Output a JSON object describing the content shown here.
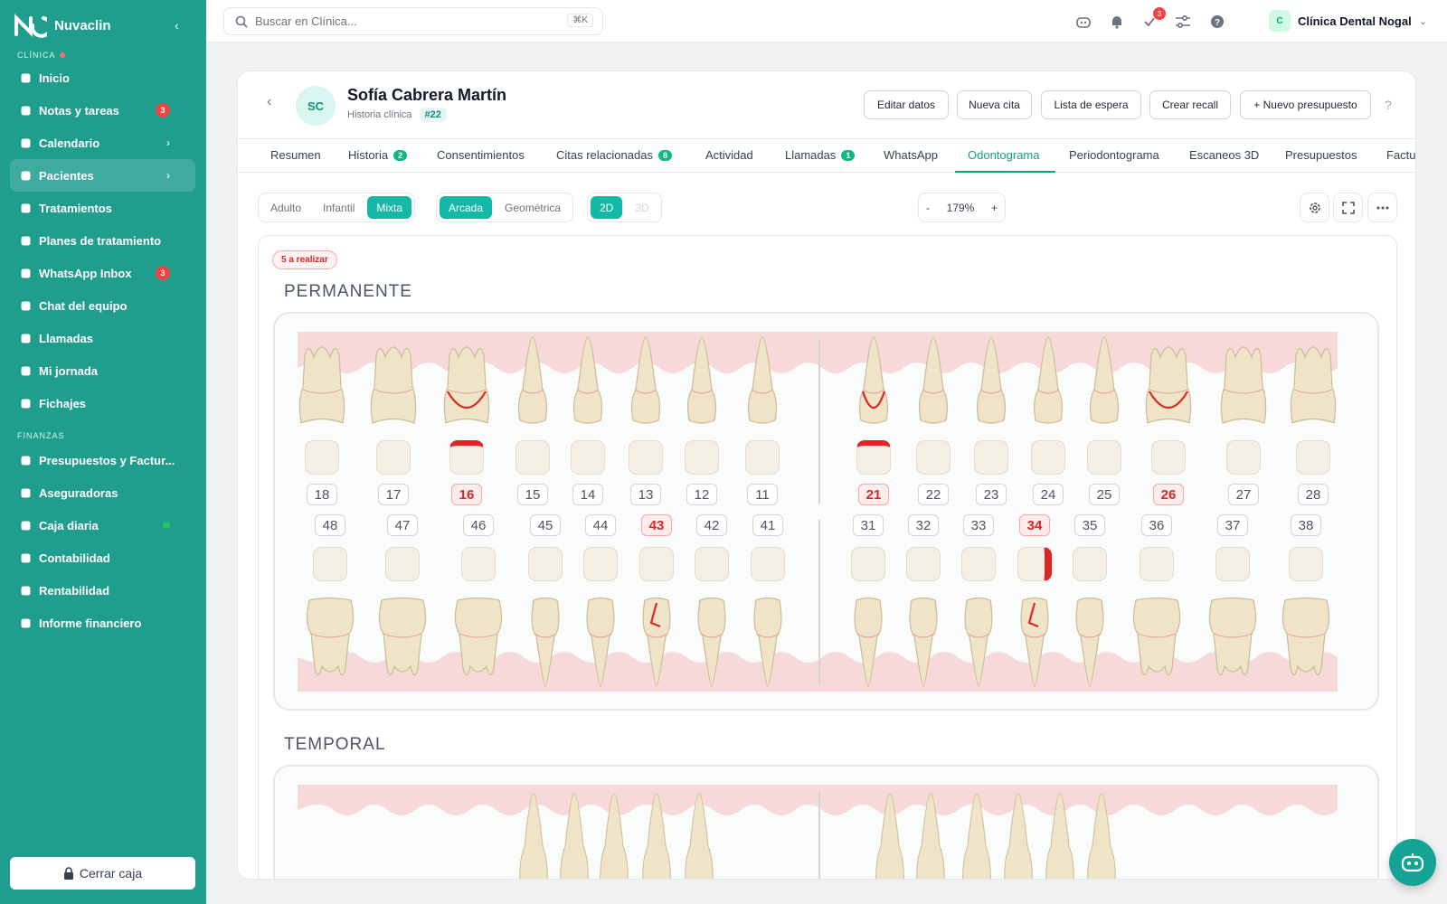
{
  "app": {
    "brand": "Nuvaclin"
  },
  "sidebar": {
    "section_clinic": "CLÍNICA",
    "section_finance": "FINANZAS",
    "items": [
      {
        "label": "Inicio",
        "icon": "home-icon"
      },
      {
        "label": "Notas y tareas",
        "icon": "notes-icon",
        "badge": "3"
      },
      {
        "label": "Calendario",
        "icon": "calendar-icon"
      },
      {
        "label": "Pacientes",
        "icon": "users-icon",
        "active": true
      },
      {
        "label": "Tratamientos",
        "icon": "flask-icon"
      },
      {
        "label": "Planes de tratamiento",
        "icon": "clipboard-icon"
      },
      {
        "label": "WhatsApp Inbox",
        "icon": "chat-icon",
        "badge": "3"
      },
      {
        "label": "Chat del equipo",
        "icon": "team-chat-icon"
      },
      {
        "label": "Llamadas",
        "icon": "phone-icon"
      },
      {
        "label": "Mi jornada",
        "icon": "clock-icon"
      },
      {
        "label": "Fichajes",
        "icon": "briefcase-icon"
      },
      {
        "label": "Presupuestos y Factur...",
        "icon": "document-icon"
      },
      {
        "label": "Aseguradoras",
        "icon": "shield-icon"
      },
      {
        "label": "Caja diaria",
        "icon": "cash-icon"
      },
      {
        "label": "Contabilidad",
        "icon": "ledger-icon"
      },
      {
        "label": "Rentabilidad",
        "icon": "trend-icon"
      },
      {
        "label": "Informe financiero",
        "icon": "bar-chart-icon"
      }
    ],
    "close_register": "Cerrar caja"
  },
  "topbar": {
    "search_placeholder": "Buscar en Clínica...",
    "search_shortcut": "⌘K",
    "tasks_badge": "3",
    "clinic_initial": "C",
    "clinic_name": "Clínica Dental Nogal"
  },
  "patient": {
    "initials": "SC",
    "name": "Sofía Cabrera Martín",
    "subtitle": "Historia clínica",
    "id": "#22",
    "actions": [
      "Editar datos",
      "Nueva cita",
      "Lista de espera",
      "Crear recall",
      "+ Nuevo presupuesto"
    ]
  },
  "tabs": [
    {
      "label": "Resumen"
    },
    {
      "label": "Historia",
      "badge": "2"
    },
    {
      "label": "Consentimientos"
    },
    {
      "label": "Citas relacionadas",
      "badge": "8"
    },
    {
      "label": "Actividad"
    },
    {
      "label": "Llamadas",
      "badge": "1"
    },
    {
      "label": "WhatsApp"
    },
    {
      "label": "Odontograma",
      "active": true
    },
    {
      "label": "Periodontograma"
    },
    {
      "label": "Escaneos 3D"
    },
    {
      "label": "Presupuestos"
    },
    {
      "label": "Factu"
    }
  ],
  "toolbar": {
    "dentition": [
      "Adulto",
      "Infantil",
      "Mixta"
    ],
    "dentition_selected": "Mixta",
    "view": [
      "Arcada",
      "Geométrica"
    ],
    "view_selected": "Arcada",
    "mode": [
      "2D",
      "3D"
    ],
    "mode_selected": "2D",
    "zoom_minus": "-",
    "zoom": "179%",
    "zoom_plus": "+"
  },
  "odontogram": {
    "pending_badge": "5 a realizar",
    "permanent_title": "PERMANENTE",
    "temporary_title": "TEMPORAL",
    "upper_teeth": [
      "18",
      "17",
      "16",
      "15",
      "14",
      "13",
      "12",
      "11",
      "21",
      "22",
      "23",
      "24",
      "25",
      "26",
      "27",
      "28"
    ],
    "lower_teeth": [
      "48",
      "47",
      "46",
      "45",
      "44",
      "43",
      "42",
      "41",
      "31",
      "32",
      "33",
      "34",
      "35",
      "36",
      "37",
      "38"
    ],
    "flagged_teeth": [
      "16",
      "21",
      "26",
      "43",
      "34"
    ],
    "colors": {
      "accent": "#1f9e8e",
      "flag": "#dc2626",
      "gum": "#f7d9d9",
      "tooth": "#efe4c8"
    }
  }
}
